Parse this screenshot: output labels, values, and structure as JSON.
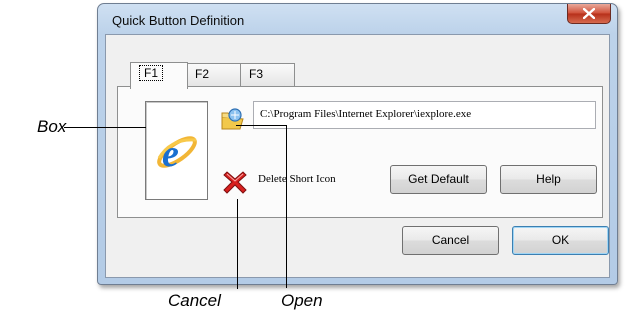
{
  "window": {
    "title": "Quick Button Definition"
  },
  "tabs": [
    {
      "label": "F1",
      "active": true
    },
    {
      "label": "F2",
      "active": false
    },
    {
      "label": "F3",
      "active": false
    }
  ],
  "program": {
    "path": "C:\\Program Files\\Internet Explorer\\iexplore.exe"
  },
  "delete": {
    "label": "Delete Short Icon"
  },
  "buttons": {
    "get_default": "Get Default",
    "help": "Help",
    "cancel": "Cancel",
    "ok": "OK"
  },
  "icons": {
    "close": "close-icon",
    "open": "open-folder-icon",
    "delete": "delete-x-icon",
    "program": "internet-explorer-icon"
  },
  "colors": {
    "title_bar": "#bcd2ea",
    "close_button": "#c9452d",
    "delete_icon": "#d42020"
  },
  "annotations": {
    "box": "Box",
    "cancel": "Cancel",
    "open": "Open"
  }
}
